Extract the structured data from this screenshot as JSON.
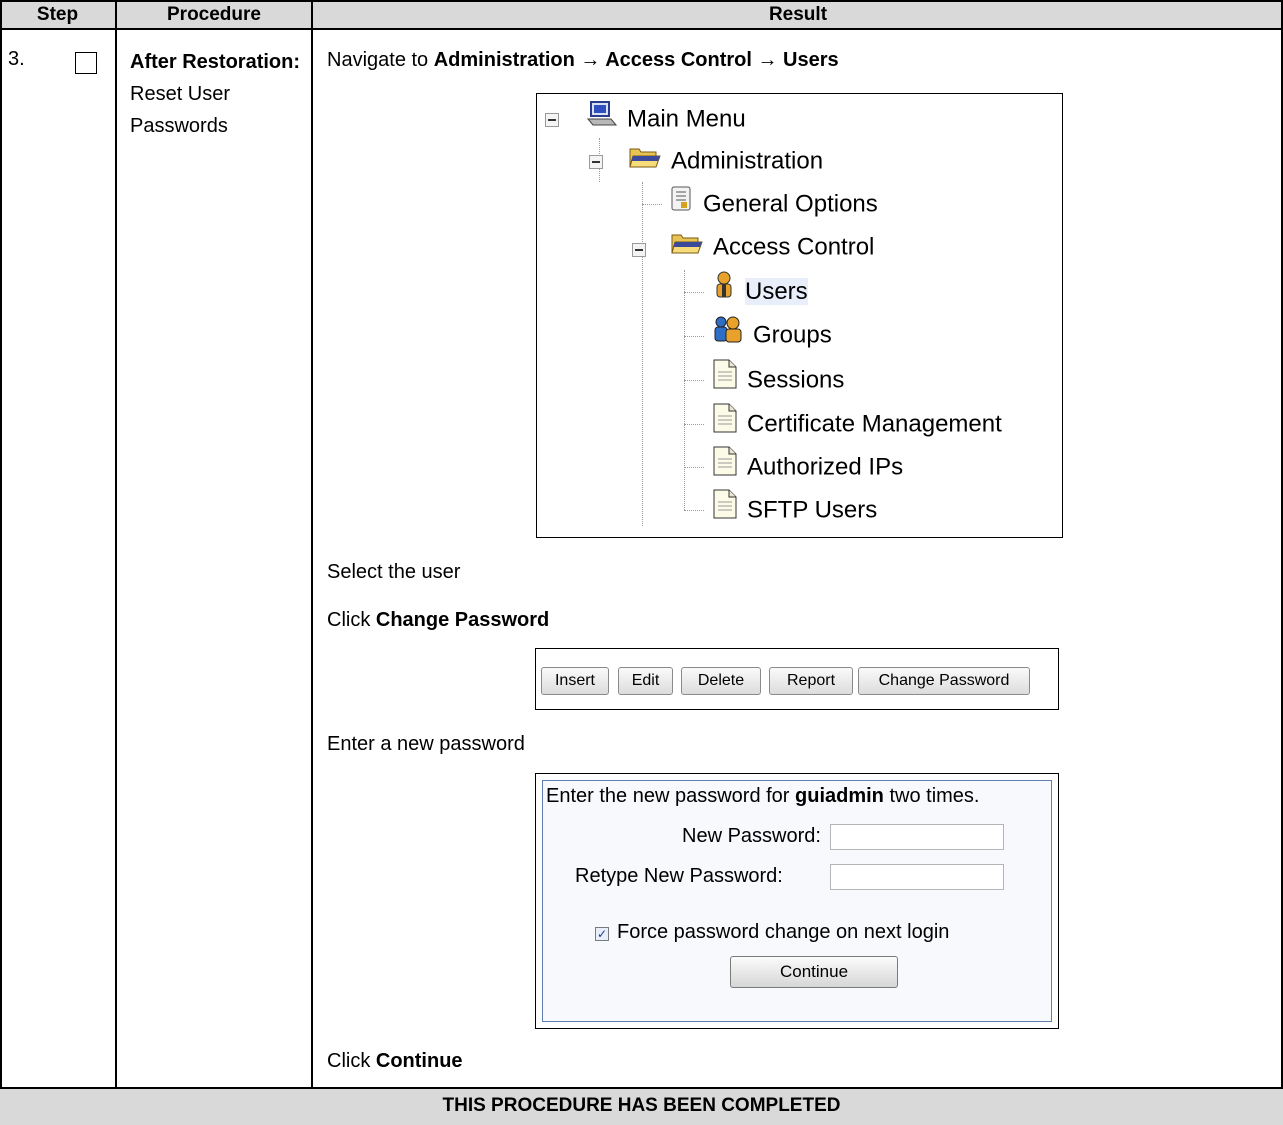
{
  "table": {
    "headers": {
      "step": "Step",
      "procedure": "Procedure",
      "result": "Result"
    },
    "step_number": "3.",
    "procedure": {
      "bold": "After Restoration:",
      "text": "Reset User Passwords"
    }
  },
  "instructions": {
    "navigate_prefix": "Navigate to ",
    "navigate_path": "Administration → Access Control → Users",
    "select_user": "Select the user",
    "click_prefix": "Click ",
    "change_password": "Change Password",
    "enter_password": "Enter a new password",
    "continue": "Continue"
  },
  "tree": {
    "main_menu": "Main Menu",
    "administration": "Administration",
    "general_options": "General Options",
    "access_control": "Access Control",
    "users": "Users",
    "groups": "Groups",
    "sessions": "Sessions",
    "certificate_management": "Certificate Management",
    "authorized_ips": "Authorized IPs",
    "sftp_users": "SFTP Users"
  },
  "buttons": {
    "insert": "Insert",
    "edit": "Edit",
    "delete": "Delete",
    "report": "Report",
    "change_password": "Change Password"
  },
  "password_dialog": {
    "prompt_prefix": "Enter the new password for ",
    "username": "guiadmin",
    "prompt_suffix": " two times.",
    "new_password_label": "New Password:",
    "retype_label": "Retype New Password:",
    "force_change_label": "Force password change on next login",
    "force_change_checked": true,
    "continue_button": "Continue"
  },
  "footer": "THIS PROCEDURE HAS BEEN COMPLETED"
}
